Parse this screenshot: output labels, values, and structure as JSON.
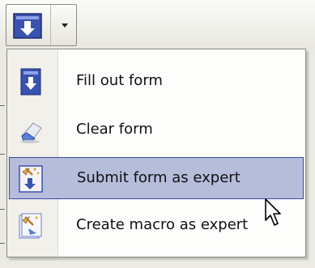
{
  "toolbar": {
    "split_button": {
      "icon": "form-download-icon",
      "menu_arrow": "chevron-down-icon"
    }
  },
  "menu": {
    "items": [
      {
        "label": "Fill out form",
        "icon": "fill-form-icon",
        "highlighted": false
      },
      {
        "label": "Clear form",
        "icon": "eraser-icon",
        "highlighted": false
      },
      {
        "label": "Submit form as expert",
        "icon": "submit-expert-icon",
        "highlighted": true
      },
      {
        "label": "Create macro as expert",
        "icon": "macro-expert-icon",
        "highlighted": false
      }
    ]
  },
  "colors": {
    "highlight_fill": "#b6bddb",
    "highlight_border": "#3a4aa8",
    "icon_blue": "#3a52b0"
  }
}
